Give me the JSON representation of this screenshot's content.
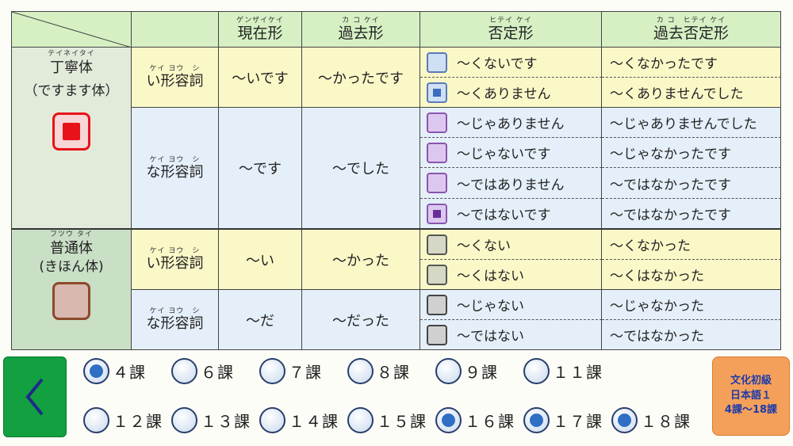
{
  "header": {
    "present": {
      "ruby": "ゲンザイケイ",
      "label": "現在形"
    },
    "past": {
      "ruby": "カ コ ケイ",
      "label": "過去形"
    },
    "negative": {
      "ruby": "ヒテイ ケイ",
      "label": "否定形"
    },
    "past_negative": {
      "ruby": "カ コ　ヒテイ ケイ",
      "label": "過去否定形"
    }
  },
  "polite": {
    "ruby": "テイネイタイ",
    "label": "丁寧体",
    "sub": "（ですます体）",
    "i_adj": {
      "ruby": "ケイ ヨウ　シ",
      "label": "い形容詞",
      "present": "～いです",
      "past": "～かったです",
      "rows": [
        {
          "neg": "～くないです",
          "past_neg": "～くなかったです"
        },
        {
          "neg": "～くありません",
          "past_neg": "～くありませんでした"
        }
      ]
    },
    "na_adj": {
      "ruby": "ケイ ヨウ　シ",
      "label": "な形容詞",
      "present": "～です",
      "past": "～でした",
      "rows": [
        {
          "neg": "～じゃありません",
          "past_neg": "～じゃありませんでした"
        },
        {
          "neg": "～じゃないです",
          "past_neg": "～じゃなかったです"
        },
        {
          "neg": "～ではありません",
          "past_neg": "～ではなかったです"
        },
        {
          "neg": "～ではないです",
          "past_neg": "～ではなかったです"
        }
      ]
    }
  },
  "plain": {
    "ruby": "フツウ タイ",
    "label": "普通体",
    "sub": "(きほん体)",
    "i_adj": {
      "ruby": "ケイ ヨウ　シ",
      "label": "い形容詞",
      "present": "～い",
      "past": "～かった",
      "rows": [
        {
          "neg": "～くない",
          "past_neg": "～くなかった"
        },
        {
          "neg": "～くはない",
          "past_neg": "～くはなかった"
        }
      ]
    },
    "na_adj": {
      "ruby": "ケイ ヨウ　シ",
      "label": "な形容詞",
      "present": "～だ",
      "past": "～だった",
      "rows": [
        {
          "neg": "～じゃない",
          "past_neg": "～じゃなかった"
        },
        {
          "neg": "～ではない",
          "past_neg": "～ではなかった"
        }
      ]
    }
  },
  "lessons": {
    "row1": [
      {
        "label": "４課",
        "selected": true
      },
      {
        "label": "６課",
        "selected": false
      },
      {
        "label": "７課",
        "selected": false
      },
      {
        "label": "８課",
        "selected": false
      },
      {
        "label": "９課",
        "selected": false
      },
      {
        "label": "１１課",
        "selected": false
      }
    ],
    "row2": [
      {
        "label": "１２課",
        "selected": false
      },
      {
        "label": "１３課",
        "selected": false
      },
      {
        "label": "１４課",
        "selected": false
      },
      {
        "label": "１５課",
        "selected": false
      },
      {
        "label": "１６課",
        "selected": true
      },
      {
        "label": "１７課",
        "selected": true
      },
      {
        "label": "１８課",
        "selected": true
      }
    ]
  },
  "book_button": {
    "line1": "文化初級",
    "line2": "日本語１",
    "line3": "4課～18課"
  },
  "colors": {
    "header_green": "#d6f0c4",
    "i_adj_yellow": "#fbf8c8",
    "na_adj_blue": "#e4eff9",
    "polite_selected": "#e8121a",
    "plain_button": "#d9b8b0",
    "back_green": "#12a040",
    "book_orange": "#f5a05a",
    "radio_selected": "#2f6fc4"
  }
}
